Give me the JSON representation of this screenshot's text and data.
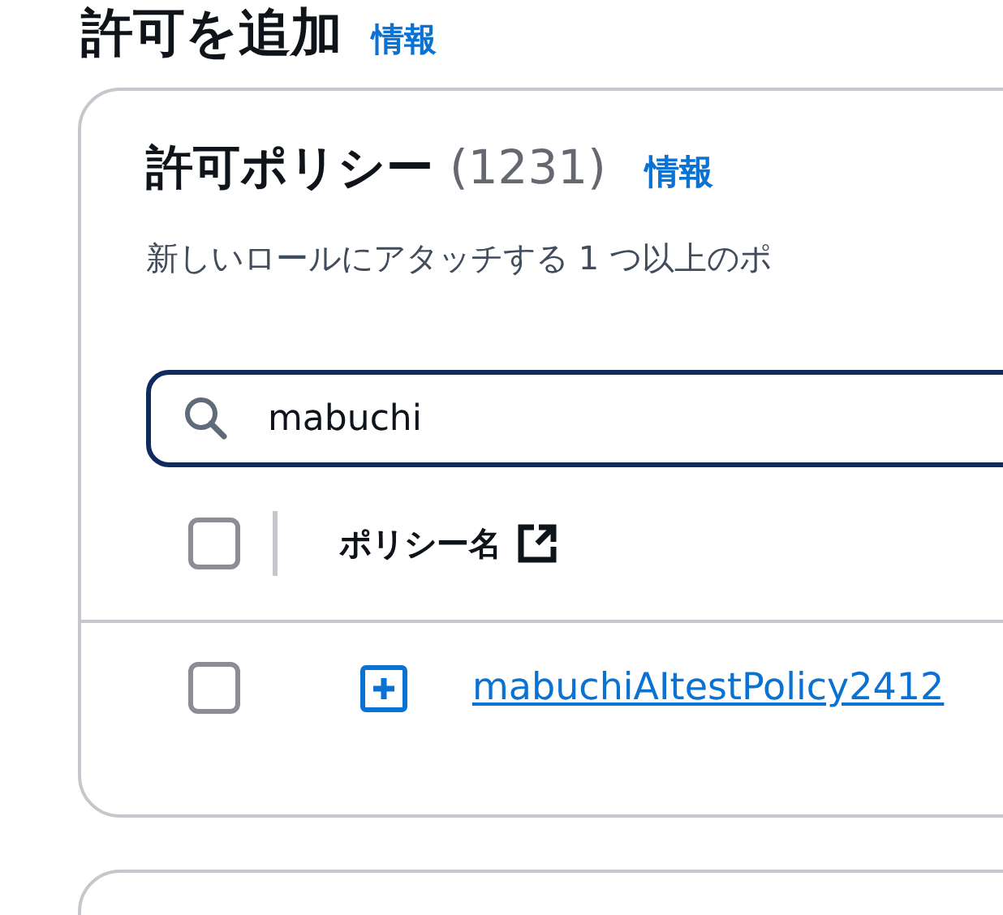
{
  "page": {
    "title": "許可を追加",
    "info_link": "情報"
  },
  "policies_card": {
    "title": "許可ポリシー",
    "count": "(1231)",
    "info_link": "情報",
    "description": "新しいロールにアタッチする 1 つ以上のポ",
    "search": {
      "value": "mabuchi"
    },
    "table": {
      "select_all": {
        "checked": false
      },
      "columns": [
        {
          "label": "ポリシー名"
        }
      ],
      "rows": [
        {
          "checked": false,
          "expanded": false,
          "name": "mabuchiAItestPolicy2412"
        }
      ]
    }
  }
}
